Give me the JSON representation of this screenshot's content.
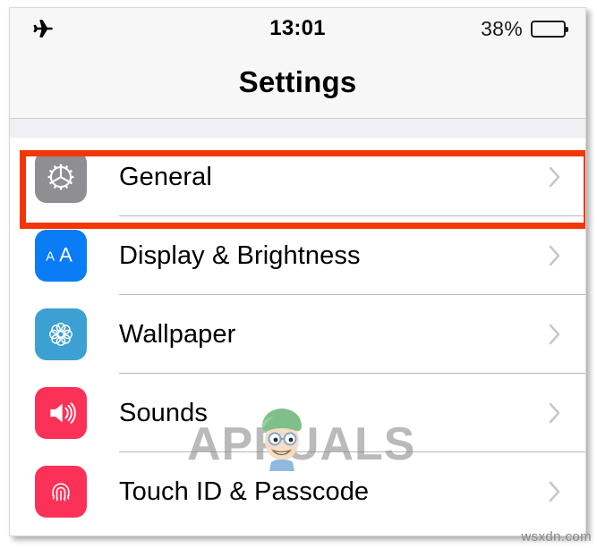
{
  "status_bar": {
    "airplane_icon": "airplane-icon",
    "time": "13:01",
    "battery_percent": "38%",
    "battery_level": 38
  },
  "nav": {
    "title": "Settings"
  },
  "settings_rows": [
    {
      "label": "General",
      "icon": "gear-icon",
      "icon_color": "#8e8e93",
      "chevron": "chevron-right-icon",
      "highlighted": true
    },
    {
      "label": "Display & Brightness",
      "icon": "text-size-aa-icon",
      "icon_color": "#0a7cf5",
      "chevron": "chevron-right-icon",
      "highlighted": false
    },
    {
      "label": "Wallpaper",
      "icon": "flower-mandala-icon",
      "icon_color": "#3da0d2",
      "chevron": "chevron-right-icon",
      "highlighted": false
    },
    {
      "label": "Sounds",
      "icon": "speaker-volume-icon",
      "icon_color": "#fc3158",
      "chevron": "chevron-right-icon",
      "highlighted": false
    },
    {
      "label": "Touch ID & Passcode",
      "icon": "fingerprint-icon",
      "icon_color": "#fc3158",
      "chevron": "chevron-right-icon",
      "highlighted": false
    }
  ],
  "annotation": {
    "color": "#f43505",
    "target": "General"
  },
  "watermark": {
    "text": "APPUALS",
    "site_mark": "wsxdn.com"
  }
}
